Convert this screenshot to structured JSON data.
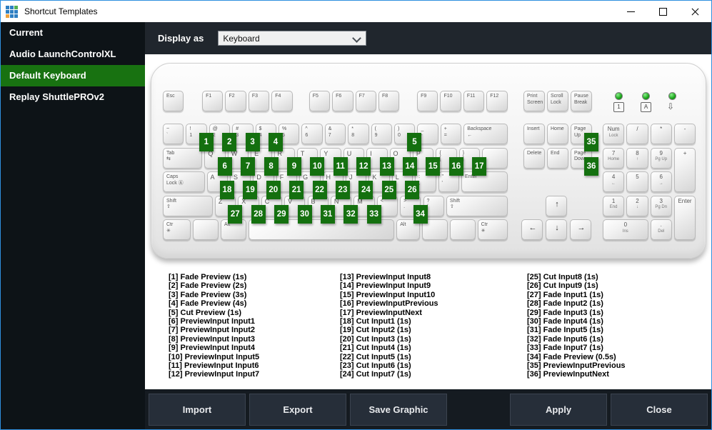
{
  "window": {
    "title": "Shortcut Templates",
    "logo_colors": [
      "#2e7fc2",
      "#2e7fc2",
      "#53b153",
      "#2e7fc2",
      "#2e7fc2",
      "#2e7fc2",
      "#f0a23c",
      "#2e7fc2",
      "#2e7fc2"
    ],
    "controls": [
      {
        "id": "minimize"
      },
      {
        "id": "maximize"
      },
      {
        "id": "close"
      }
    ]
  },
  "sidebar": {
    "items": [
      {
        "label": "Current",
        "selected": false
      },
      {
        "label": "Audio LaunchControlXL",
        "selected": false
      },
      {
        "label": "Default Keyboard",
        "selected": true
      },
      {
        "label": "Replay ShuttlePROv2",
        "selected": false
      }
    ]
  },
  "toolbar": {
    "display_as_label": "Display as",
    "display_as_value": "Keyboard"
  },
  "colors": {
    "window_border": "#2f8fde",
    "sidebar_bg": "#0d1317",
    "selected_green": "#187211",
    "badge_green": "#14700f",
    "toolbar_bg": "#20262d",
    "footer_bg": "#151b21",
    "button_bg": "#262e39"
  },
  "keyboard": {
    "main_rows": [
      [
        {
          "t": [
            "Esc"
          ]
        },
        {
          "t": [
            "F1"
          ],
          "g": 0.7
        },
        {
          "t": [
            "F2"
          ]
        },
        {
          "t": [
            "F3"
          ]
        },
        {
          "t": [
            "F4"
          ]
        },
        {
          "t": [
            "F5"
          ],
          "g": 0.62
        },
        {
          "t": [
            "F6"
          ]
        },
        {
          "t": [
            "F7"
          ]
        },
        {
          "t": [
            "F8"
          ]
        },
        {
          "t": [
            "F9"
          ],
          "g": 0.67
        },
        {
          "t": [
            "F10"
          ]
        },
        {
          "t": [
            "F11"
          ]
        },
        {
          "t": [
            "F12"
          ]
        }
      ],
      [
        {
          "t": [
            "~",
            "`"
          ]
        },
        {
          "t": [
            "!",
            "1"
          ],
          "b": 1
        },
        {
          "t": [
            "@",
            "2"
          ],
          "b": 2
        },
        {
          "t": [
            "#",
            "3"
          ],
          "b": 3
        },
        {
          "t": [
            "$",
            "4"
          ],
          "b": 4
        },
        {
          "t": [
            "%",
            "5"
          ]
        },
        {
          "t": [
            "^",
            "6"
          ]
        },
        {
          "t": [
            "&",
            "7"
          ]
        },
        {
          "t": [
            "*",
            "8"
          ]
        },
        {
          "t": [
            "(",
            "9"
          ]
        },
        {
          "t": [
            ")",
            "0"
          ],
          "b": 5
        },
        {
          "t": [
            "_",
            "-"
          ]
        },
        {
          "t": [
            "+",
            "="
          ]
        },
        {
          "t": [
            "Backspace",
            "←"
          ],
          "w": 2
        }
      ],
      [
        {
          "t": [
            "Tab",
            "⇆"
          ],
          "w": 1.8
        },
        {
          "t": [
            "Q"
          ],
          "b": 6
        },
        {
          "t": [
            "W"
          ],
          "b": 7
        },
        {
          "t": [
            "E"
          ],
          "b": 8
        },
        {
          "t": [
            "R"
          ],
          "b": 9
        },
        {
          "t": [
            "T"
          ],
          "b": 10
        },
        {
          "t": [
            "Y"
          ],
          "b": 11
        },
        {
          "t": [
            "U"
          ],
          "b": 12
        },
        {
          "t": [
            "I"
          ],
          "b": 13
        },
        {
          "t": [
            "O"
          ],
          "b": 14
        },
        {
          "t": [
            "P"
          ],
          "b": 15
        },
        {
          "t": [
            "{",
            "["
          ],
          "b": 16
        },
        {
          "t": [
            "}",
            "]"
          ],
          "b": 17
        },
        {
          "t": [],
          "w": 1.2
        }
      ],
      [
        {
          "t": [
            "Caps",
            "Lock Ⓐ"
          ],
          "w": 1.9
        },
        {
          "t": [
            "A"
          ],
          "b": 18
        },
        {
          "t": [
            "S"
          ],
          "b": 19
        },
        {
          "t": [
            "D"
          ],
          "b": 20
        },
        {
          "t": [
            "F"
          ],
          "b": 21
        },
        {
          "t": [
            "G"
          ],
          "b": 22
        },
        {
          "t": [
            "H"
          ],
          "b": 23
        },
        {
          "t": [
            "J"
          ],
          "b": 24
        },
        {
          "t": [
            "K"
          ],
          "b": 25
        },
        {
          "t": [
            "L"
          ],
          "b": 26
        },
        {
          "t": [
            ":",
            ";"
          ]
        },
        {
          "t": [
            "\"",
            "'"
          ]
        },
        {
          "t": [
            "Enter"
          ],
          "w": 2.1
        }
      ],
      [
        {
          "t": [
            "Shift",
            "⇧"
          ],
          "w": 2.25
        },
        {
          "t": [
            "Z"
          ],
          "b": 27
        },
        {
          "t": [
            "X"
          ],
          "b": 28
        },
        {
          "t": [
            "C"
          ],
          "b": 29
        },
        {
          "t": [
            "V"
          ],
          "b": 30
        },
        {
          "t": [
            "B"
          ],
          "b": 31
        },
        {
          "t": [
            "N"
          ],
          "b": 32
        },
        {
          "t": [
            "M"
          ],
          "b": 33
        },
        {
          "t": [
            "<",
            ","
          ]
        },
        {
          "t": [
            ">",
            "."
          ],
          "b": 34
        },
        {
          "t": [
            "?",
            "/"
          ]
        },
        {
          "t": [
            "Shift",
            "⇧"
          ],
          "w": 2.75
        }
      ],
      [
        {
          "t": [
            "Ctr",
            "✳"
          ],
          "w": 1.3
        },
        {
          "t": [],
          "w": 1.2
        },
        {
          "t": [
            "Alt"
          ],
          "w": 1.2
        },
        {
          "t": [],
          "w": 6.4
        },
        {
          "t": [
            "Alt"
          ],
          "w": 1.1
        },
        {
          "t": [],
          "w": 1.2
        },
        {
          "t": [],
          "w": 1.2
        },
        {
          "t": [
            "Ctr",
            "✳"
          ],
          "w": 1.4
        }
      ]
    ],
    "nav_rows": [
      [
        {
          "t": [
            "Print",
            "Screen"
          ]
        },
        {
          "t": [
            "Scroll",
            "Lock"
          ]
        },
        {
          "t": [
            "Pause",
            "Break"
          ]
        }
      ],
      [
        {
          "t": [
            "Insert"
          ]
        },
        {
          "t": [
            "Home"
          ]
        },
        {
          "t": [
            "Page",
            "Up"
          ],
          "b": 35
        }
      ],
      [
        {
          "t": [
            "Delete"
          ]
        },
        {
          "t": [
            "End"
          ]
        },
        {
          "t": [
            "Page",
            "Down"
          ],
          "b": 36
        }
      ]
    ],
    "numpad_rows": [
      [
        {
          "t": [
            "Num",
            "Lock"
          ]
        },
        {
          "t": [
            "/"
          ]
        },
        {
          "t": [
            "*"
          ]
        },
        {
          "t": [
            "-"
          ]
        }
      ],
      [
        {
          "t": [
            "7",
            "Home"
          ]
        },
        {
          "t": [
            "8",
            "↑"
          ]
        },
        {
          "t": [
            "9",
            "Pg Up"
          ]
        },
        {
          "t": [
            "+"
          ],
          "h": 62.5
        }
      ],
      [
        {
          "t": [
            "4",
            "←"
          ]
        },
        {
          "t": [
            "5"
          ]
        },
        {
          "t": [
            "6",
            "→"
          ]
        }
      ],
      [
        {
          "t": [
            "1",
            "End"
          ]
        },
        {
          "t": [
            "2",
            "↓"
          ]
        },
        {
          "t": [
            "3",
            "Pg Dn"
          ]
        },
        {
          "t": [
            "Enter"
          ],
          "h": 62.5
        }
      ],
      [
        {
          "t": [
            "0",
            "Ins"
          ],
          "w": 2
        },
        {
          "t": [
            ".",
            "Del"
          ]
        }
      ]
    ],
    "arrow_keys": [
      {
        "t": "↑"
      },
      {
        "t": "←"
      },
      {
        "t": "↓"
      },
      {
        "t": "→"
      }
    ],
    "leds": [
      {
        "label": "1",
        "boxed": true
      },
      {
        "label": "A",
        "boxed": true
      },
      {
        "label": "⇩",
        "boxed": false
      }
    ]
  },
  "shortcuts": {
    "columns": [
      [
        "[1] Fade Preview (1s)",
        "[2] Fade Preview (2s)",
        "[3] Fade Preview (3s)",
        "[4] Fade Preview (4s)",
        "[5] Cut Preview (1s)",
        "[6] PreviewInput Input1",
        "[7] PreviewInput Input2",
        "[8] PreviewInput Input3",
        "[9] PreviewInput Input4",
        "[10] PreviewInput Input5",
        "[11] PreviewInput Input6",
        "[12] PreviewInput Input7"
      ],
      [
        "[13] PreviewInput Input8",
        "[14] PreviewInput Input9",
        "[15] PreviewInput Input10",
        "[16] PreviewInputPrevious",
        "[17] PreviewInputNext",
        "[18] Cut Input1 (1s)",
        "[19] Cut Input2 (1s)",
        "[20] Cut Input3 (1s)",
        "[21] Cut Input4 (1s)",
        "[22] Cut Input5 (1s)",
        "[23] Cut Input6 (1s)",
        "[24] Cut Input7 (1s)"
      ],
      [
        "[25] Cut Input8 (1s)",
        "[26] Cut Input9 (1s)",
        "[27] Fade Input1 (1s)",
        "[28] Fade Input2 (1s)",
        "[29] Fade Input3 (1s)",
        "[30] Fade Input4 (1s)",
        "[31] Fade Input5 (1s)",
        "[32] Fade Input6 (1s)",
        "[33] Fade Input7 (1s)",
        "[34] Fade Preview (0.5s)",
        "[35] PreviewInputPrevious",
        "[36] PreviewInputNext"
      ]
    ]
  },
  "footer": {
    "left_buttons": [
      {
        "id": "import",
        "label": "Import"
      },
      {
        "id": "export",
        "label": "Export"
      },
      {
        "id": "save-graphic",
        "label": "Save Graphic"
      }
    ],
    "right_buttons": [
      {
        "id": "apply",
        "label": "Apply"
      },
      {
        "id": "close",
        "label": "Close"
      }
    ]
  }
}
